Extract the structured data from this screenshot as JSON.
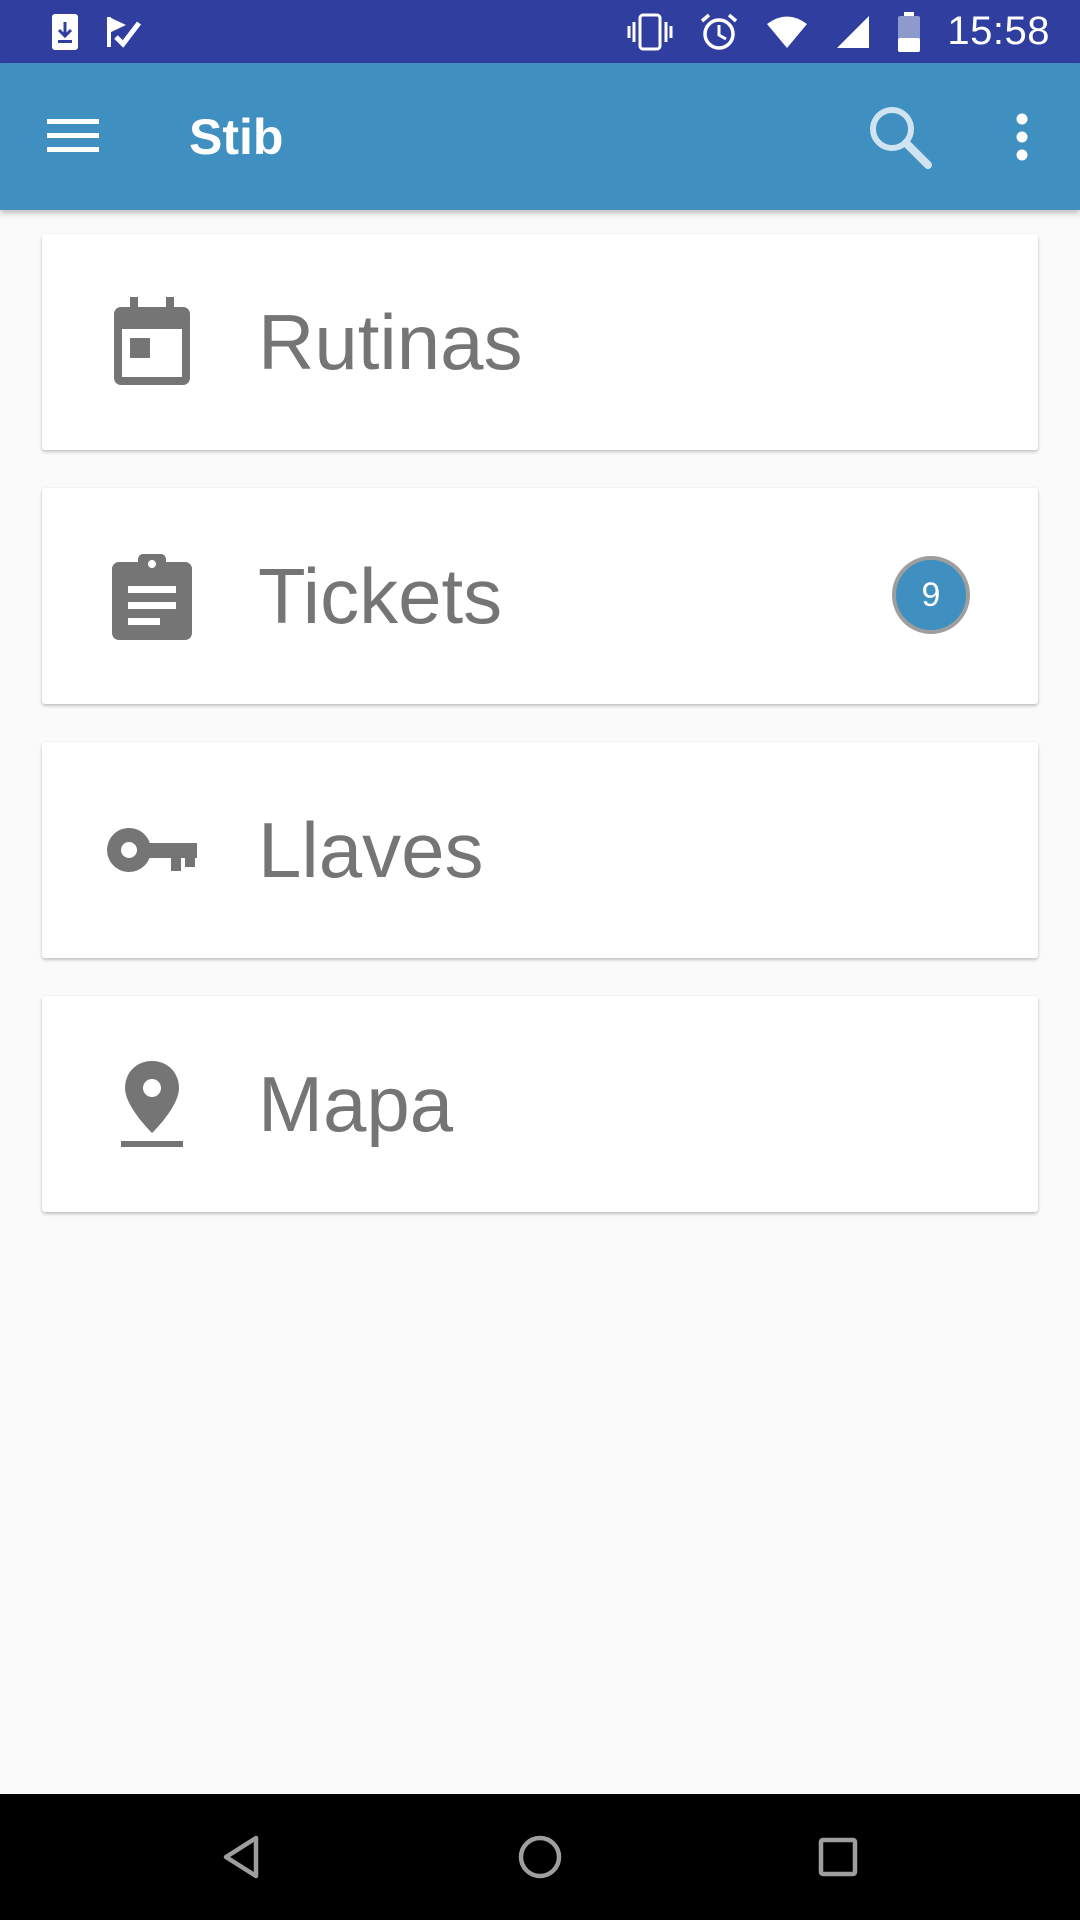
{
  "status_bar": {
    "time": "15:58",
    "left_icons": [
      "download-icon",
      "check-flag-icon"
    ],
    "right_icons": [
      "vibrate-icon",
      "alarm-icon",
      "wifi-icon",
      "cell-signal-icon",
      "battery-icon"
    ]
  },
  "app_bar": {
    "title": "Stib",
    "menu_icon": "hamburger-menu-icon",
    "search_icon": "search-icon",
    "more_icon": "more-vert-icon"
  },
  "cards": [
    {
      "label": "Rutinas",
      "icon": "calendar-icon"
    },
    {
      "label": "Tickets",
      "icon": "clipboard-icon",
      "badge": "9"
    },
    {
      "label": "Llaves",
      "icon": "key-icon"
    },
    {
      "label": "Mapa",
      "icon": "place-pin-icon"
    }
  ],
  "colors": {
    "status_bar": "#303f9f",
    "app_bar": "#3f8fc0",
    "badge": "#3f8fc0",
    "card_text": "#757575",
    "background": "#fafafa"
  },
  "nav_bar": {
    "icons": [
      "back-icon",
      "home-icon",
      "recents-icon"
    ]
  }
}
